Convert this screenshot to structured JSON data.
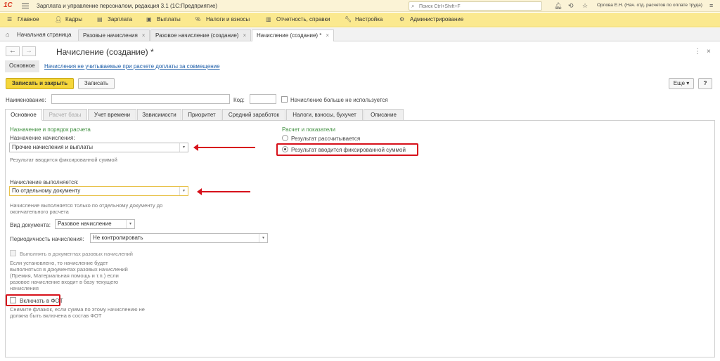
{
  "titlebar": {
    "logo": "1С",
    "app_title": "Зарплата и управление персоналом, редакция 3.1  (1С:Предприятие)",
    "search_placeholder": "Поиск Ctrl+Shift+F",
    "user": "Орлова Е.Н. (Нач. отд. расчетов по оплате труда)"
  },
  "sections": [
    {
      "label": "Главное",
      "icon": "menu-icon"
    },
    {
      "label": "Кадры",
      "icon": "people-icon"
    },
    {
      "label": "Зарплата",
      "icon": "calculator-icon"
    },
    {
      "label": "Выплаты",
      "icon": "wallet-icon"
    },
    {
      "label": "Налоги и взносы",
      "icon": "percent-icon"
    },
    {
      "label": "Отчетность, справки",
      "icon": "reports-icon"
    },
    {
      "label": "Настройка",
      "icon": "wrench-icon"
    },
    {
      "label": "Администрирование",
      "icon": "admin-icon"
    }
  ],
  "open_tabs": [
    {
      "label": "Начальная страница"
    },
    {
      "label": "Разовые начисления",
      "close": "×"
    },
    {
      "label": "Разовое начисление (создание)",
      "close": "×"
    },
    {
      "label": "Начисление (создание) *",
      "close": "×"
    }
  ],
  "form": {
    "title": "Начисление (создание) *",
    "more_menu": "⋮",
    "close": "×",
    "subnav_main": "Основное",
    "subnav_link": "Начисления не учитываемые при расчете доплаты за совмещение",
    "save_close": "Записать и закрыть",
    "save": "Записать",
    "more": "Еще",
    "help": "?",
    "name_label": "Наименование:",
    "name_value": "",
    "code_label": "Код:",
    "code_value": "",
    "not_used_label": "Начисление больше не используется"
  },
  "inner_tabs": [
    "Основное",
    "Расчет базы",
    "Учет времени",
    "Зависимости",
    "Приоритет",
    "Средний заработок",
    "Налоги, взносы, бухучет",
    "Описание"
  ],
  "left": {
    "group_title": "Назначение и порядок расчета",
    "purpose_label": "Назначение начисления:",
    "purpose_value": "Прочие начисления и выплаты",
    "purpose_hint": "Результат вводится фиксированной суммой",
    "performed_label": "Начисление выполняется:",
    "performed_value": "По отдельному документу",
    "performed_hint_1": "Начисление выполняется только по отдельному документу до",
    "performed_hint_2": "окончательного расчета",
    "doc_type_label": "Вид документа:",
    "doc_type_value": "Разовое начисление",
    "periodicity_label": "Периодичность начисления:",
    "periodicity_value": "Не контролировать",
    "onetime_label": "Выполнять в документах разовых начислений",
    "onetime_hint": [
      "Если установлено, то начисление будет",
      "выполняться в документах разовых начислений",
      "(Премия, Материальная помощь и т.п.) если",
      "разовое начисление входит в базу текущего",
      "начисления"
    ],
    "fot_label": "Включать в ФОТ",
    "fot_hint": [
      "Снимите флажок, если сумма по этому начислению не",
      "должна быть включена в состав ФОТ"
    ]
  },
  "right": {
    "group_title": "Расчет и показатели",
    "radio_calc": "Результат рассчитывается",
    "radio_fixed": "Результат вводится фиксированной суммой"
  },
  "colors": {
    "highlight": "#d7111b",
    "section_bar": "#fbe98f",
    "primary_button": "#f5d63b"
  }
}
